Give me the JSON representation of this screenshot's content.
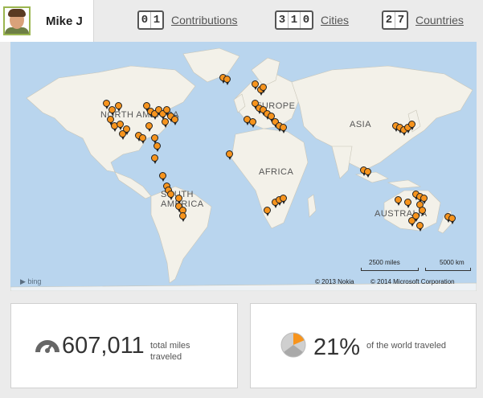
{
  "profile": {
    "name": "Mike J"
  },
  "stats": [
    {
      "digits": [
        "0",
        "1"
      ],
      "label": "Contributions"
    },
    {
      "digits": [
        "3",
        "1",
        "0"
      ],
      "label": "Cities"
    },
    {
      "digits": [
        "2",
        "7"
      ],
      "label": "Countries"
    }
  ],
  "map": {
    "continents": [
      "NORTH AMERICA",
      "EUROPE",
      "ASIA",
      "AFRICA",
      "SOUTH AMERICA",
      "AUSTRALIA"
    ],
    "scale_miles": "2500 miles",
    "scale_km": "5000 km",
    "copyright_nokia": "© 2013 Nokia",
    "copyright_microsoft": "© 2014 Microsoft Corporation",
    "provider": "bing",
    "pin_color": "#f7941d"
  },
  "metrics": {
    "miles": {
      "value": "607,011",
      "label": "total miles traveled",
      "icon": "speedometer-icon"
    },
    "world": {
      "value": "21%",
      "label": "of the world traveled",
      "icon": "globe-pie-icon"
    }
  }
}
